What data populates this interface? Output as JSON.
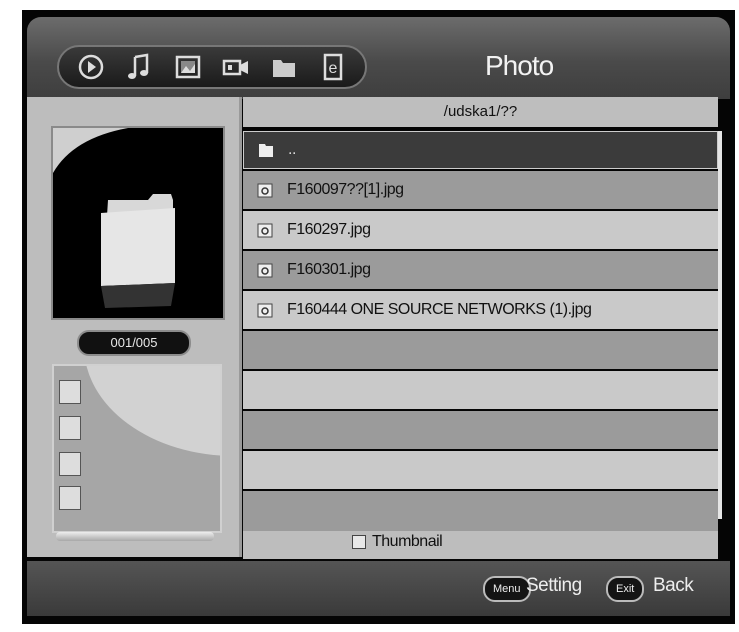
{
  "header": {
    "title": "Photo"
  },
  "toolbar": {
    "icons": [
      "play-icon",
      "music-icon",
      "photo-icon",
      "video-icon",
      "folder-icon",
      "ebook-icon"
    ]
  },
  "preview": {
    "counter": "001/005"
  },
  "path": "/udska1/??",
  "files": [
    {
      "name": "..",
      "type": "folder",
      "selected": true
    },
    {
      "name": "F160097??[1].jpg",
      "type": "image"
    },
    {
      "name": "F160297.jpg",
      "type": "image"
    },
    {
      "name": "F160301.jpg",
      "type": "image"
    },
    {
      "name": "F160444 ONE SOURCE NETWORKS (1).jpg",
      "type": "image"
    }
  ],
  "thumbnail": {
    "label": "Thumbnail"
  },
  "footer": {
    "menu_key": "Menu",
    "menu_label": "Setting",
    "exit_key": "Exit",
    "exit_label": "Back"
  }
}
